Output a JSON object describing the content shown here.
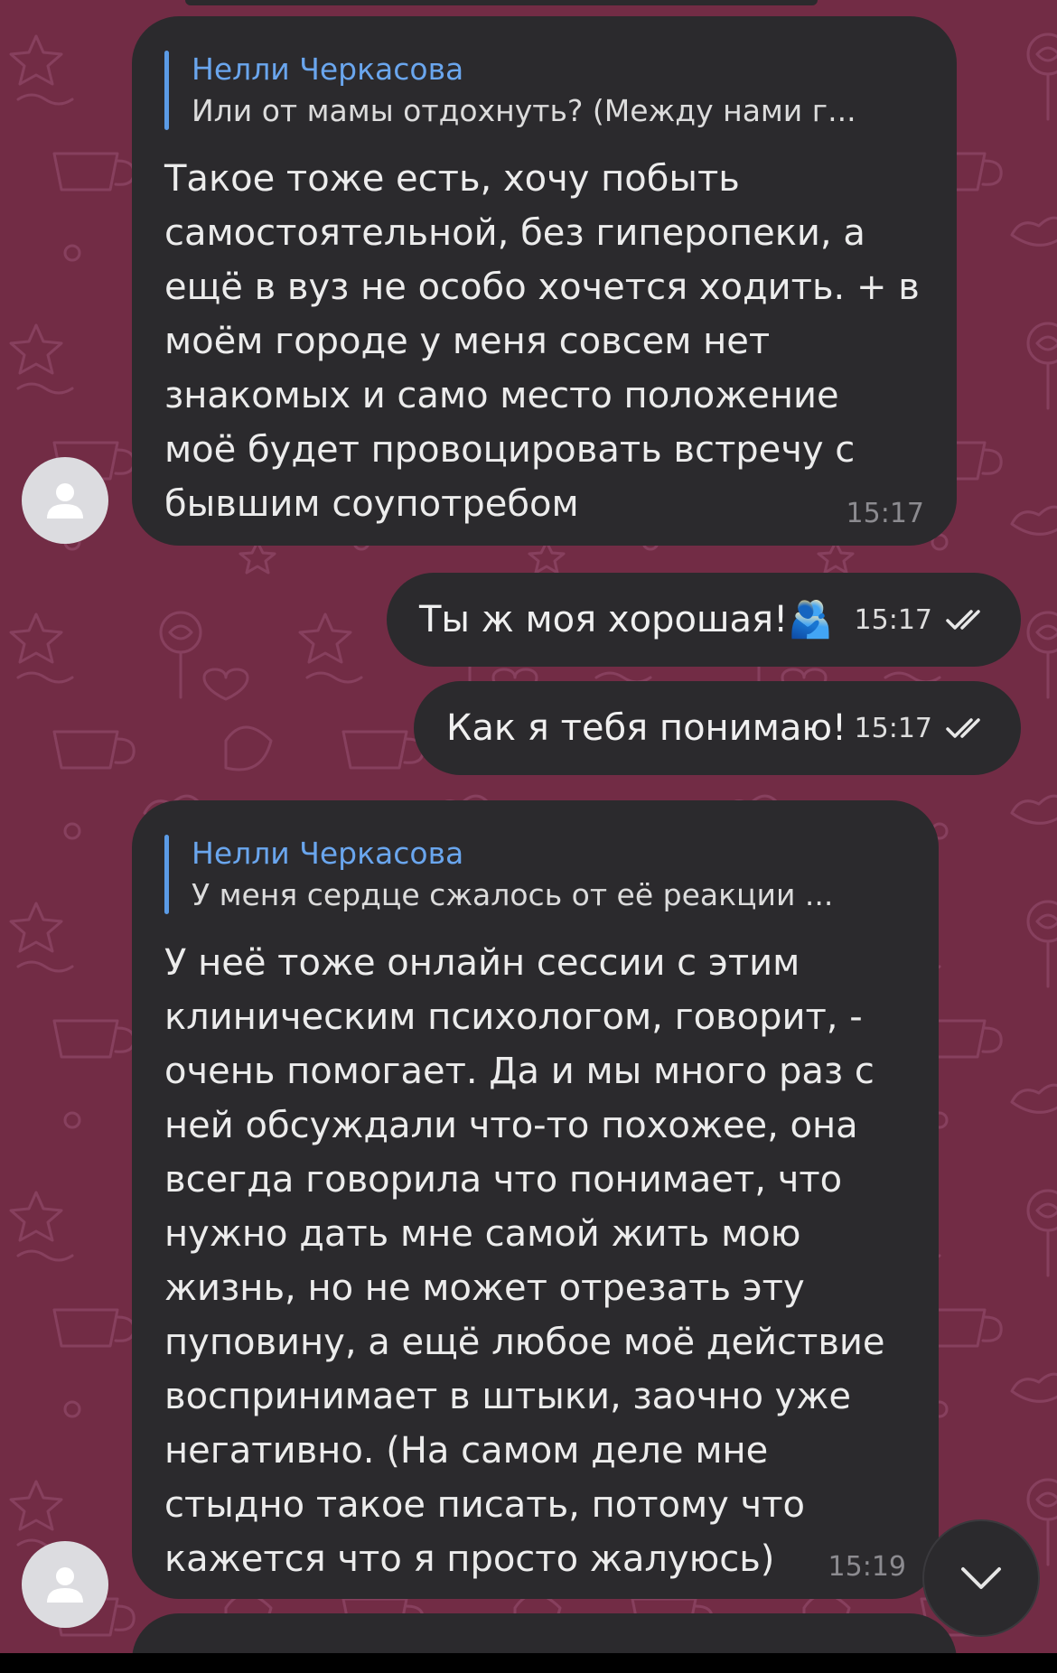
{
  "messages": [
    {
      "reply_author": "Нелли Черкасова",
      "reply_preview": "Или от мамы отдохнуть? (Между нами г...",
      "lines": [
        "Такое тоже есть, хочу побыть",
        "самостоятельной, без гиперопеки, а",
        "ещё в вуз не особо хочется ходить. + в",
        "моём городе у меня совсем нет",
        "знакомых и само место положение",
        "моё будет провоцировать встречу с",
        "бывшим соупотребом"
      ],
      "time": "15:17"
    },
    {
      "text": "Ты ж моя хорошая!🫂",
      "time": "15:17"
    },
    {
      "text": "Как я тебя понимаю!",
      "time": "15:17"
    },
    {
      "reply_author": "Нелли Черкасова",
      "reply_preview": "У меня сердце сжалось от её реакции ...",
      "lines": [
        "У неё тоже онлайн сессии с этим",
        "клиническим психологом, говорит, -",
        "очень помогает. Да и мы много раз с",
        "ней обсуждали что-то похожее, она",
        "всегда говорила что понимает, что",
        "нужно дать мне самой жить мою",
        "жизнь, но не может отрезать эту",
        "пуповину, а ещё любое моё действие",
        "воспринимает в штыки, заочно уже",
        "негативно. (На самом деле мне",
        "стыдно такое писать, потому что",
        "кажется что я просто жалуюсь)"
      ],
      "time": "15:19"
    }
  ],
  "colors": {
    "background": "#722c45",
    "incoming_bubble": "#2b2a2d",
    "reply_accent": "#5b9be6"
  },
  "icons": [
    "avatar-placeholder-icon",
    "double-check-icon",
    "chevron-down-icon"
  ]
}
